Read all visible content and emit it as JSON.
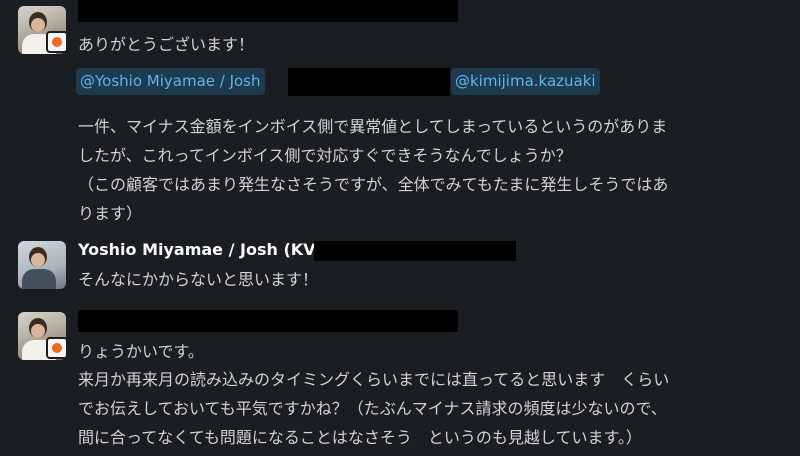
{
  "messages": [
    {
      "lines": [
        "ありがとうございます！"
      ]
    },
    {
      "mentions": [
        "@Yoshio Miyamae / Josh",
        "@kimijima.kazuaki"
      ],
      "lines": [
        "一件、マイナス金額をインボイス側で異常値としてしまっているというのがありま",
        "したが、これってインボイス側で対応すぐできそうなんでしょうか？",
        "（この顧客ではあまり発生なさそうですが、全体でみてもたまに発生しそうではあ",
        "ります）"
      ]
    },
    {
      "sender": "Yoshio Miyamae / Josh (KV)",
      "lines": [
        "そんなにかからないと思います！"
      ]
    },
    {
      "lines": [
        "りょうかいです。",
        "来月か再来月の読み込みのタイミングくらいまでには直ってると思います　くらい",
        "でお伝えしておいても平気ですかね？（たぶんマイナス請求の頻度は少ないので、",
        "間に合ってなくても問題になることはなさそう　というのも見越しています。）"
      ]
    }
  ],
  "colors": {
    "background": "#1a1d21",
    "mention_bg": "#1d3a4f",
    "mention_text": "#5cb6e8",
    "badge_accent": "#ef6a1a"
  }
}
